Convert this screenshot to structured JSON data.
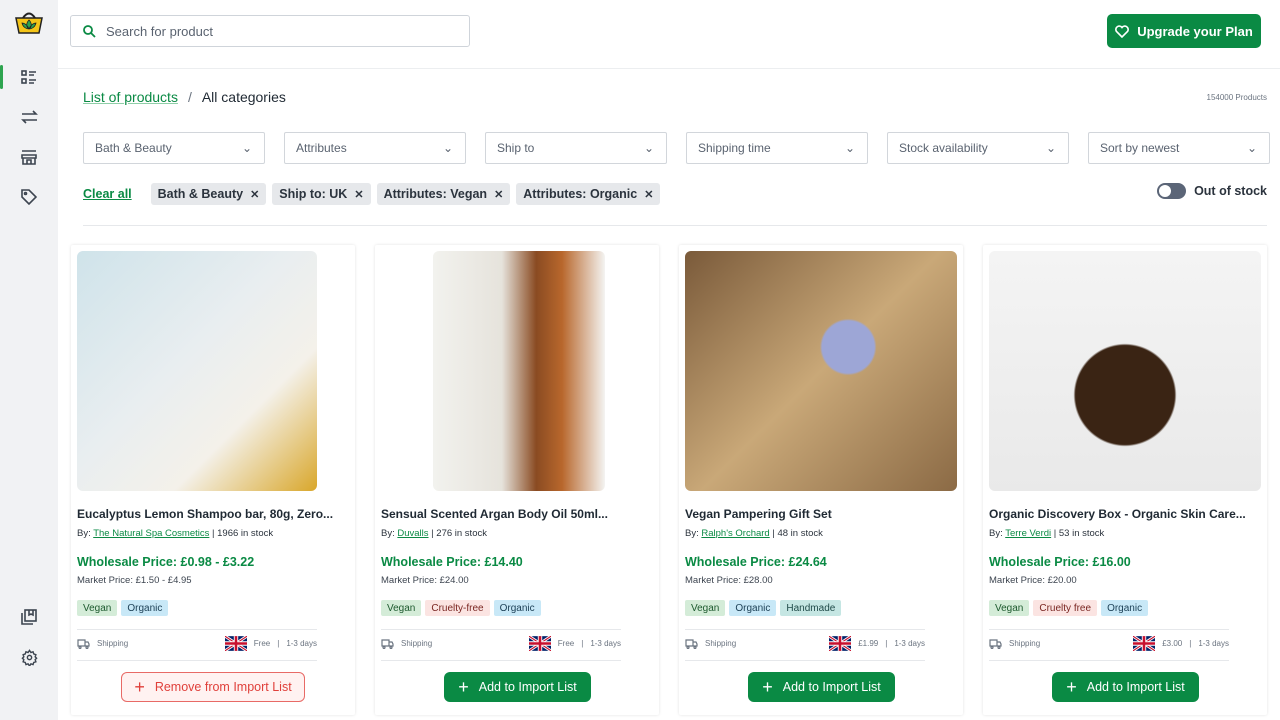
{
  "header": {
    "search_placeholder": "Search for product",
    "upgrade_label": "Upgrade your Plan"
  },
  "breadcrumb": {
    "link": "List of products",
    "separator": "/",
    "current": "All categories"
  },
  "product_count": "154000 Products",
  "filters": [
    "Bath & Beauty",
    "Attributes",
    "Ship to",
    "Shipping time",
    "Stock availability",
    "Sort by newest"
  ],
  "active_filters": {
    "clear_label": "Clear all",
    "chips": [
      "Bath & Beauty",
      "Ship to: UK",
      "Attributes: Vegan",
      "Attributes: Organic"
    ]
  },
  "out_of_stock": {
    "label": "Out of stock",
    "enabled": false
  },
  "colors": {
    "brand": "#0a8a44",
    "remove": "#e0403b"
  },
  "products": [
    {
      "title": "Eucalyptus Lemon Shampoo bar, 80g, Zero...",
      "by_label": "By:",
      "seller": "The Natural Spa Cosmetics",
      "stock": "1966 in stock",
      "wholesale": "Wholesale Price: £0.98 - £3.22",
      "market": "Market Price: £1.50 - £4.95",
      "tags": [
        "Vegan",
        "Organic"
      ],
      "shipping_label": "Shipping",
      "ship_cost": "Free",
      "ship_time": "1-3 days",
      "button": "Remove from Import List",
      "in_list": true
    },
    {
      "title": "Sensual Scented Argan Body Oil 50ml...",
      "by_label": "By:",
      "seller": "Duvalls",
      "stock": "276 in stock",
      "wholesale": "Wholesale Price: £14.40",
      "market": "Market Price:  £24.00",
      "tags": [
        "Vegan",
        "Cruelty-free",
        "Organic"
      ],
      "shipping_label": "Shipping",
      "ship_cost": "Free",
      "ship_time": "1-3 days",
      "button": "Add to Import List",
      "in_list": false
    },
    {
      "title": "Vegan Pampering Gift Set",
      "by_label": "By:",
      "seller": "Ralph's Orchard",
      "stock": "48 in stock",
      "wholesale": "Wholesale Price: £24.64",
      "market": "Market Price:  £28.00",
      "tags": [
        "Vegan",
        "Organic",
        "Handmade"
      ],
      "shipping_label": "Shipping",
      "ship_cost": "£1.99",
      "ship_time": "1-3 days",
      "button": "Add to Import List",
      "in_list": false
    },
    {
      "title": "Organic Discovery Box - Organic Skin Care...",
      "by_label": "By:",
      "seller": "Terre Verdi",
      "stock": "53 in stock",
      "wholesale": "Wholesale Price: £16.00",
      "market": "Market Price: £20.00",
      "tags": [
        "Vegan",
        "Cruelty free",
        "Organic"
      ],
      "shipping_label": "Shipping",
      "ship_cost": "£3.00",
      "ship_time": "1-3 days",
      "button": "Add to Import List",
      "in_list": false
    }
  ]
}
